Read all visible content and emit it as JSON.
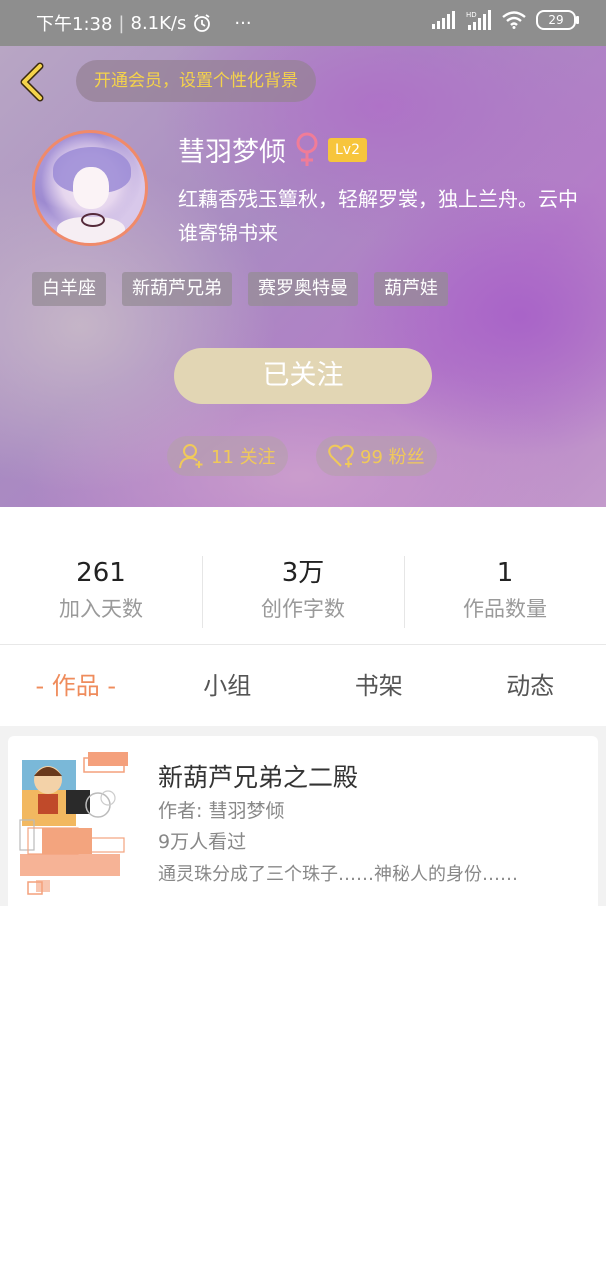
{
  "status_bar": {
    "time": "下午1:38",
    "speed": "8.1K/s",
    "more": "···",
    "battery": "29"
  },
  "profile": {
    "vip_banner": "开通会员，设置个性化背景",
    "username": "彗羽梦倾",
    "level": "Lv2",
    "bio": "红藕香残玉簟秋，轻解罗裳，独上兰舟。云中谁寄锦书来",
    "tags": [
      "白羊座",
      "新葫芦兄弟",
      "赛罗奥特曼",
      "葫芦娃"
    ],
    "follow_button": "已关注",
    "following": "11 关注",
    "fans": "99 粉丝"
  },
  "stats": [
    {
      "value": "261",
      "label": "加入天数"
    },
    {
      "value": "3万",
      "label": "创作字数"
    },
    {
      "value": "1",
      "label": "作品数量"
    }
  ],
  "tabs": [
    "- 作品 -",
    "小组",
    "书架",
    "动态"
  ],
  "works": [
    {
      "title": "新葫芦兄弟之二殿",
      "author": "作者: 彗羽梦倾",
      "views": "9万人看过",
      "desc": "通灵珠分成了三个珠子……神秘人的身份……"
    }
  ],
  "colors": {
    "accent": "#ef8c5c",
    "gold": "#f5d34a",
    "follow_btn": "#e2d6b4",
    "level_badge": "#f7c53c"
  }
}
